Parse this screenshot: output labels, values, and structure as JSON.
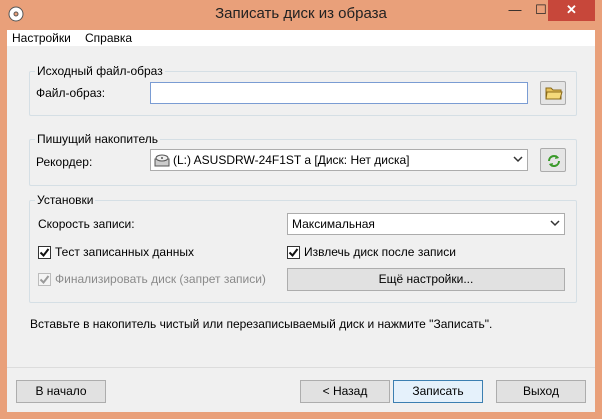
{
  "window": {
    "title": "Записать диск из образа",
    "min_glyph": "—",
    "max_glyph": "☐",
    "close_glyph": "✕"
  },
  "menu": {
    "settings": "Настройки",
    "help": "Справка"
  },
  "source_group": {
    "title": "Исходный файл-образ",
    "file_label": "Файл-образ:",
    "file_value": ""
  },
  "drive_group": {
    "title": "Пишущий накопитель",
    "recorder_label": "Рекордер:",
    "recorder_value": "(L:) ASUSDRW-24F1ST   a [Диск: Нет диска]"
  },
  "settings_group": {
    "title": "Установки",
    "speed_label": "Скорость записи:",
    "speed_value": "Максимальная",
    "verify_label": "Тест записанных данных",
    "verify_checked": true,
    "eject_label": "Извлечь диск после записи",
    "eject_checked": true,
    "finalize_label": "Финализировать диск (запрет записи)",
    "finalize_checked": true,
    "finalize_disabled": true,
    "more_settings": "Ещё настройки..."
  },
  "hint": "Вставьте в накопитель чистый или перезаписываемый диск и нажмите \"Записать\".",
  "footer": {
    "home": "В начало",
    "back": "< Назад",
    "burn": "Записать",
    "exit": "Выход"
  },
  "colors": {
    "titlebar": "#e9a07a",
    "close_button": "#c7473a",
    "client_bg": "#f0f0f0"
  },
  "icons": [
    "app-icon",
    "folder-icon",
    "cd-drive-icon",
    "refresh-icon",
    "chevron-down-icon",
    "checkmark-icon"
  ]
}
